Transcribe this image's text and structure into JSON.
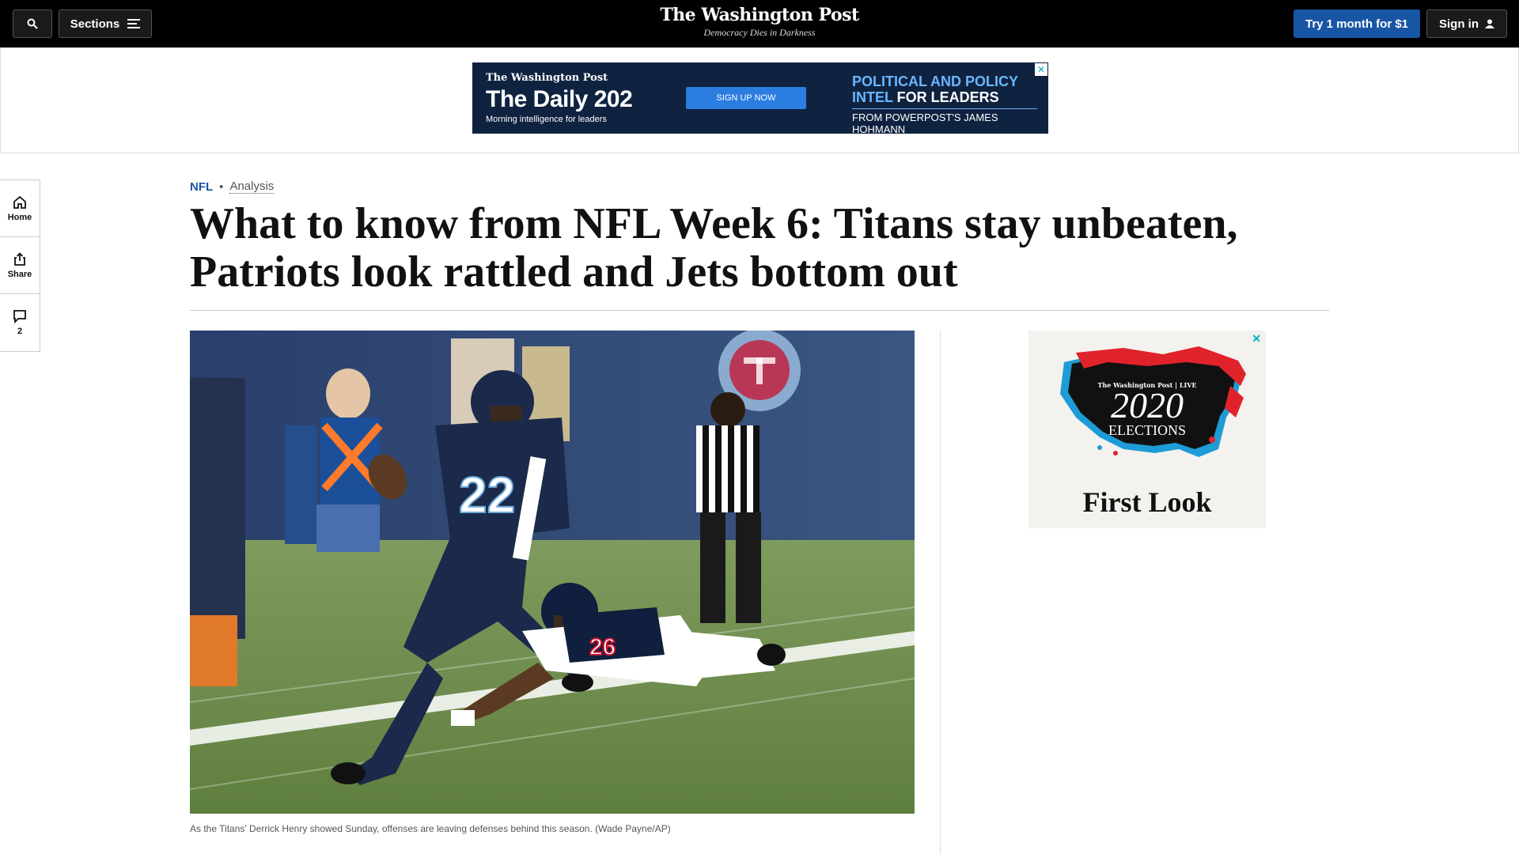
{
  "header": {
    "sections_label": "Sections",
    "brand": "The Washington Post",
    "tagline": "Democracy Dies in Darkness",
    "subscribe_label": "Try 1 month for $1",
    "signin_label": "Sign in"
  },
  "top_ad": {
    "mini_logo": "The Washington Post",
    "title": "The Daily 202",
    "subtitle": "Morning intelligence for leaders",
    "cta": "SIGN UP NOW",
    "policy_line1": "POLITICAL AND POLICY",
    "policy_line2_a": "INTEL",
    "policy_line2_b": " FOR LEADERS",
    "from": "FROM POWERPOST'S JAMES HOHMANN",
    "close": "✕"
  },
  "rail": {
    "home_label": "Home",
    "share_label": "Share",
    "comments_count": "2"
  },
  "article": {
    "kicker": "NFL",
    "label": "Analysis",
    "headline": "What to know from NFL Week 6: Titans stay unbeaten, Patriots look rattled and Jets bottom out",
    "caption": "As the Titans' Derrick Henry showed Sunday, offenses are leaving defenses behind this season. (Wade Payne/AP)"
  },
  "side_ad": {
    "logo": "The Washington Post | LIVE",
    "year": "2020",
    "word": "ELECTIONS",
    "first_look": "First Look",
    "close": "✕"
  },
  "colors": {
    "accent_blue": "#1955a5",
    "titans_navy": "#1b2a4a",
    "field_green": "#6e8f4a"
  }
}
